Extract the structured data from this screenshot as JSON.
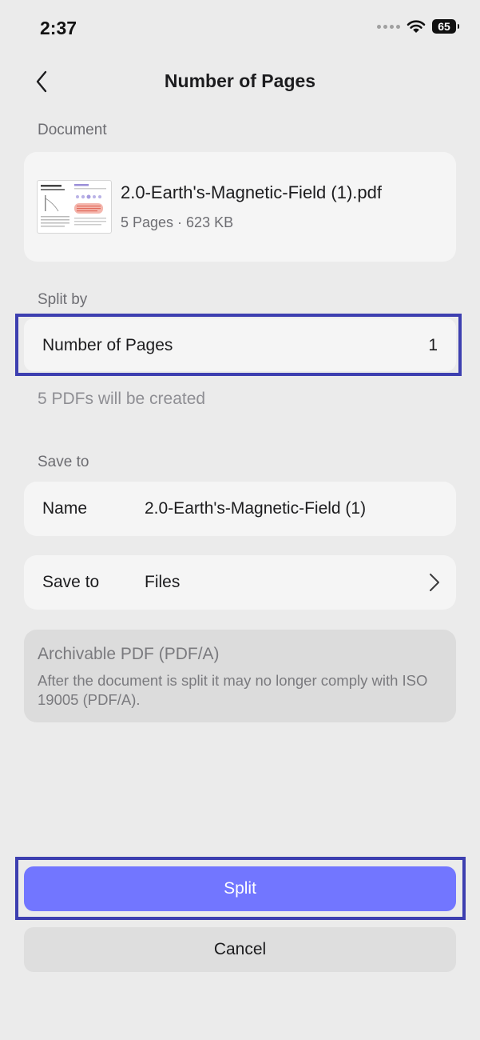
{
  "status_bar": {
    "time": "2:37",
    "battery": "65"
  },
  "nav": {
    "title": "Number of Pages"
  },
  "document_section": {
    "label": "Document",
    "file_name": "2.0-Earth's-Magnetic-Field (1).pdf",
    "meta": "5 Pages · 623 KB"
  },
  "split_section": {
    "label": "Split by",
    "option_label": "Number of Pages",
    "option_value": "1",
    "result_text": "5 PDFs will be created"
  },
  "save_section": {
    "label": "Save to",
    "name_label": "Name",
    "name_value": "2.0-Earth's-Magnetic-Field (1)",
    "location_label": "Save to",
    "location_value": "Files"
  },
  "archive": {
    "title": "Archivable PDF (PDF/A)",
    "description": "After the document is split it may no longer comply with ISO 19005 (PDF/A)."
  },
  "actions": {
    "split_label": "Split",
    "cancel_label": "Cancel"
  },
  "colors": {
    "accent": "#7276ff",
    "highlight": "#3d3fb0",
    "background": "#ebebeb",
    "card": "#f5f5f5"
  }
}
